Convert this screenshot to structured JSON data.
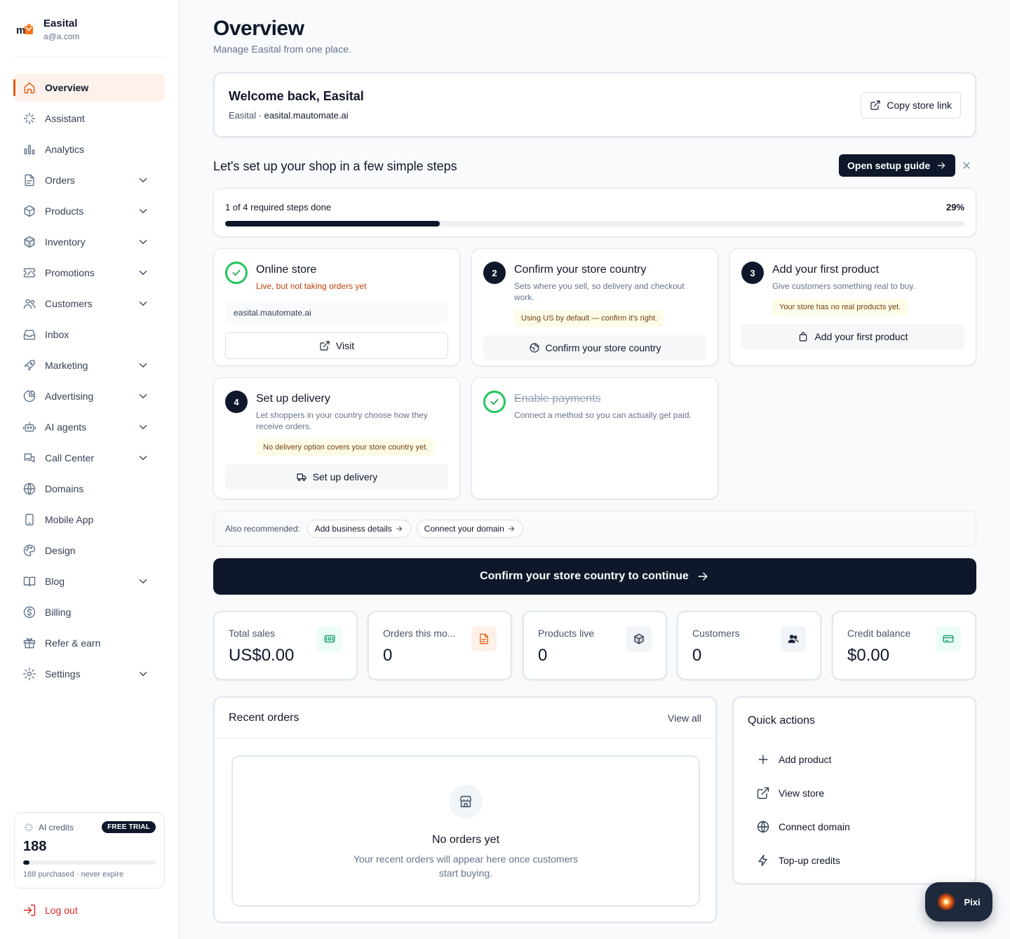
{
  "brand": {
    "name": "Easital",
    "email": "a@a.com"
  },
  "nav": [
    {
      "label": "Overview",
      "icon": "home-icon",
      "active": true,
      "expandable": false
    },
    {
      "label": "Assistant",
      "icon": "sparkles-icon",
      "expandable": false
    },
    {
      "label": "Analytics",
      "icon": "bar-chart-icon",
      "expandable": false
    },
    {
      "label": "Orders",
      "icon": "file-icon",
      "expandable": true
    },
    {
      "label": "Products",
      "icon": "box-icon",
      "expandable": true
    },
    {
      "label": "Inventory",
      "icon": "package-icon",
      "expandable": true
    },
    {
      "label": "Promotions",
      "icon": "ticket-icon",
      "expandable": true
    },
    {
      "label": "Customers",
      "icon": "users-icon",
      "expandable": true
    },
    {
      "label": "Inbox",
      "icon": "inbox-icon",
      "expandable": false
    },
    {
      "label": "Marketing",
      "icon": "rocket-icon",
      "expandable": true
    },
    {
      "label": "Advertising",
      "icon": "pie-chart-icon",
      "expandable": true
    },
    {
      "label": "AI agents",
      "icon": "bot-icon",
      "expandable": true
    },
    {
      "label": "Call Center",
      "icon": "chat-icon",
      "expandable": true
    },
    {
      "label": "Domains",
      "icon": "globe-icon",
      "expandable": false
    },
    {
      "label": "Mobile App",
      "icon": "smartphone-icon",
      "expandable": false
    },
    {
      "label": "Design",
      "icon": "palette-icon",
      "expandable": false
    },
    {
      "label": "Blog",
      "icon": "book-icon",
      "expandable": true
    },
    {
      "label": "Billing",
      "icon": "dollar-circle-icon",
      "expandable": false
    },
    {
      "label": "Refer & earn",
      "icon": "gift-icon",
      "expandable": false
    },
    {
      "label": "Settings",
      "icon": "settings-icon",
      "expandable": true
    }
  ],
  "credits": {
    "label": "AI credits",
    "badge": "FREE TRIAL",
    "value": "188",
    "used_fraction": 0.05,
    "sub": "188 purchased · never expire"
  },
  "logout_label": "Log out",
  "header": {
    "title": "Overview",
    "subtitle": "Manage Easital from one place."
  },
  "welcome": {
    "title": "Welcome back, Easital",
    "store_name": "Easital",
    "separator": " · ",
    "store_url": "easital.mautomate.ai",
    "copy_label": "Copy store link"
  },
  "setup": {
    "title": "Let's set up your shop in a few simple steps",
    "guide_label": "Open setup guide",
    "progress_label": "1 of 4 required steps done",
    "progress_percent_label": "29%",
    "progress_fraction": 0.29
  },
  "steps": {
    "online_store": {
      "title": "Online store",
      "desc": "Live, but not taking orders yet",
      "url": "easital.mautomate.ai",
      "button": "Visit"
    },
    "country": {
      "num": "2",
      "title": "Confirm your store country",
      "desc": "Sets where you sell, so delivery and checkout work.",
      "note": "Using US by default — confirm it's right.",
      "button": "Confirm your store country"
    },
    "product": {
      "num": "3",
      "title": "Add your first product",
      "desc": "Give customers something real to buy.",
      "note": "Your store has no real products yet.",
      "button": "Add your first product"
    },
    "delivery": {
      "num": "4",
      "title": "Set up delivery",
      "desc": "Let shoppers in your country choose how they receive orders.",
      "note": "No delivery option covers your store country yet.",
      "button": "Set up delivery"
    },
    "payments": {
      "title": "Enable payments",
      "desc": "Connect a method so you can actually get paid."
    }
  },
  "recommended": {
    "label": "Also recommended:",
    "items": [
      "Add business details",
      "Connect your domain"
    ]
  },
  "cta_label": "Confirm your store country to continue",
  "stats": [
    {
      "label": "Total sales",
      "value": "US$0.00",
      "icon": "cash-icon",
      "bg": "#ecfdf5",
      "color": "#059669"
    },
    {
      "label": "Orders this mo...",
      "value": "0",
      "icon": "document-icon",
      "bg": "#fff1e8",
      "color": "#ea580c"
    },
    {
      "label": "Products live",
      "value": "0",
      "icon": "cube-icon",
      "bg": "#f1f5f9",
      "color": "#1e293b"
    },
    {
      "label": "Customers",
      "value": "0",
      "icon": "users-icon",
      "bg": "#f1f5f9",
      "color": "#1e293b"
    },
    {
      "label": "Credit balance",
      "value": "$0.00",
      "icon": "credit-card-icon",
      "bg": "#ecfdf5",
      "color": "#059669"
    }
  ],
  "recent_orders": {
    "title": "Recent orders",
    "view_all": "View all",
    "empty_title": "No orders yet",
    "empty_desc": "Your recent orders will appear here once customers start buying."
  },
  "quick_actions": {
    "title": "Quick actions",
    "items": [
      {
        "label": "Add product",
        "icon": "plus-icon"
      },
      {
        "label": "View store",
        "icon": "external-link-icon"
      },
      {
        "label": "Connect domain",
        "icon": "globe-icon"
      },
      {
        "label": "Top-up credits",
        "icon": "zap-icon"
      }
    ]
  },
  "assistant_bubble": "Pixi"
}
